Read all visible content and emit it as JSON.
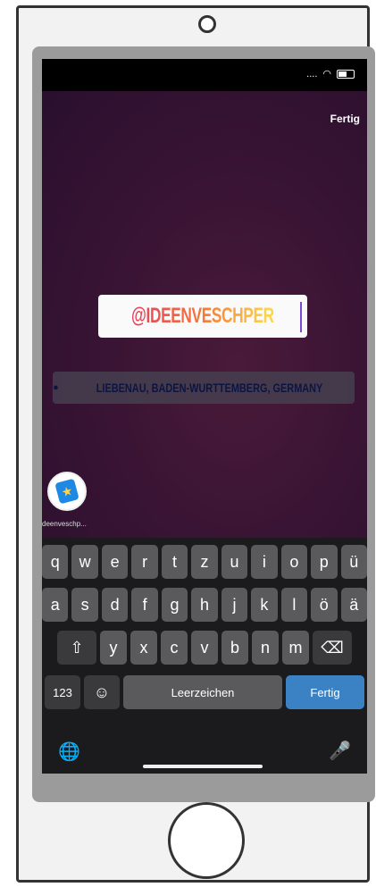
{
  "status": {
    "carrier_dots": "....",
    "wifi_icon": "wifi-icon",
    "battery_icon": "battery-icon"
  },
  "story": {
    "done_label": "Fertig",
    "mention_text": "@IDEENVESCHPER",
    "location_text": "LIEBENAU, BADEN-WURTTEMBERG, GERMANY",
    "avatar_name": "deenveschp..."
  },
  "keyboard": {
    "row1": [
      "q",
      "w",
      "e",
      "r",
      "t",
      "z",
      "u",
      "i",
      "o",
      "p",
      "ü"
    ],
    "row2": [
      "a",
      "s",
      "d",
      "f",
      "g",
      "h",
      "j",
      "k",
      "l",
      "ö",
      "ä"
    ],
    "row3": [
      "y",
      "x",
      "c",
      "v",
      "b",
      "n",
      "m"
    ],
    "numbers_label": "123",
    "space_label": "Leerzeichen",
    "done_label": "Fertig"
  },
  "colors": {
    "accent_blue": "#3b82c4",
    "mention_gradient_start": "#e4405f",
    "mention_gradient_end": "#fcd44d"
  }
}
